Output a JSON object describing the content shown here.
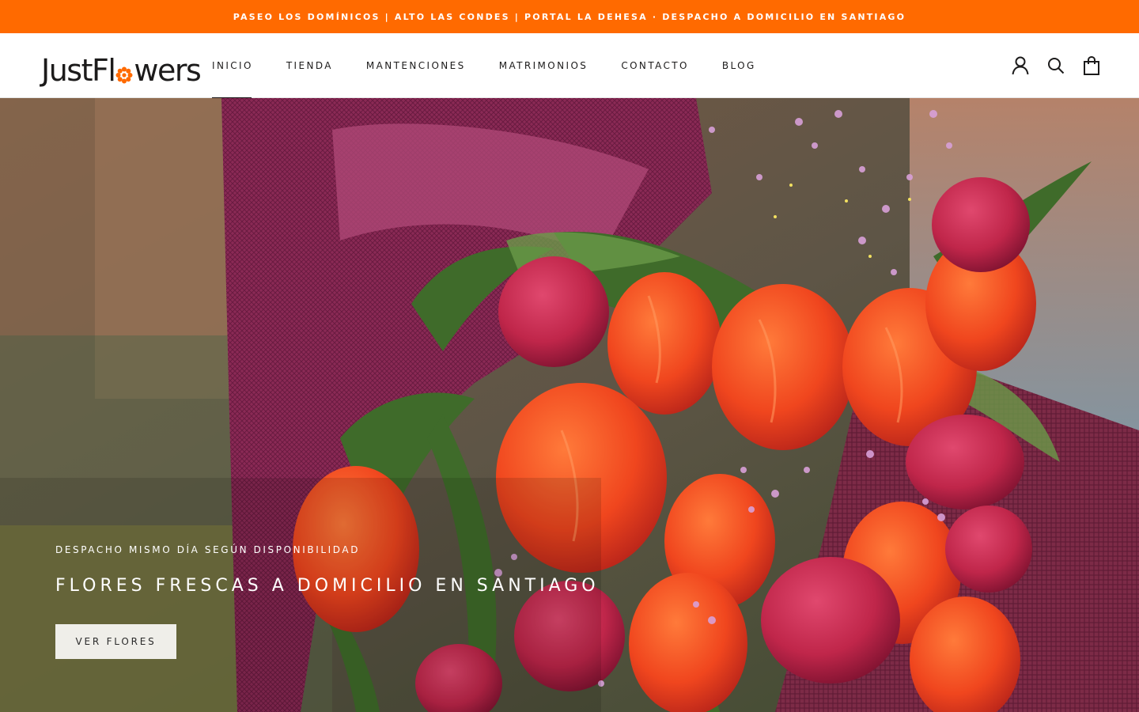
{
  "announcement": {
    "text": "PASEO LOS DOMÍNICOS | ALTO LAS CONDES | PORTAL LA DEHESA · DESPACHO A DOMICILIO EN SANTIAGO"
  },
  "header": {
    "logo": {
      "part1": "JustFl",
      "part2": "wers"
    },
    "nav": [
      {
        "label": "INICIO",
        "active": true
      },
      {
        "label": "TIENDA"
      },
      {
        "label": "MANTENCIONES"
      },
      {
        "label": "MATRIMONIOS"
      },
      {
        "label": "CONTACTO"
      },
      {
        "label": "BLOG"
      }
    ],
    "icons": [
      "account-icon",
      "search-icon",
      "cart-icon"
    ]
  },
  "hero": {
    "subtitle": "DESPACHO MISMO DÍA SEGÚN DISPONIBILIDAD",
    "title": "FLORES FRESCAS A DOMICILIO EN SANTIAGO",
    "button_label": "VER FLORES"
  },
  "colors": {
    "accent": "#ff6a00",
    "text": "#1c1b1b",
    "button_bg": "#efeee9"
  }
}
